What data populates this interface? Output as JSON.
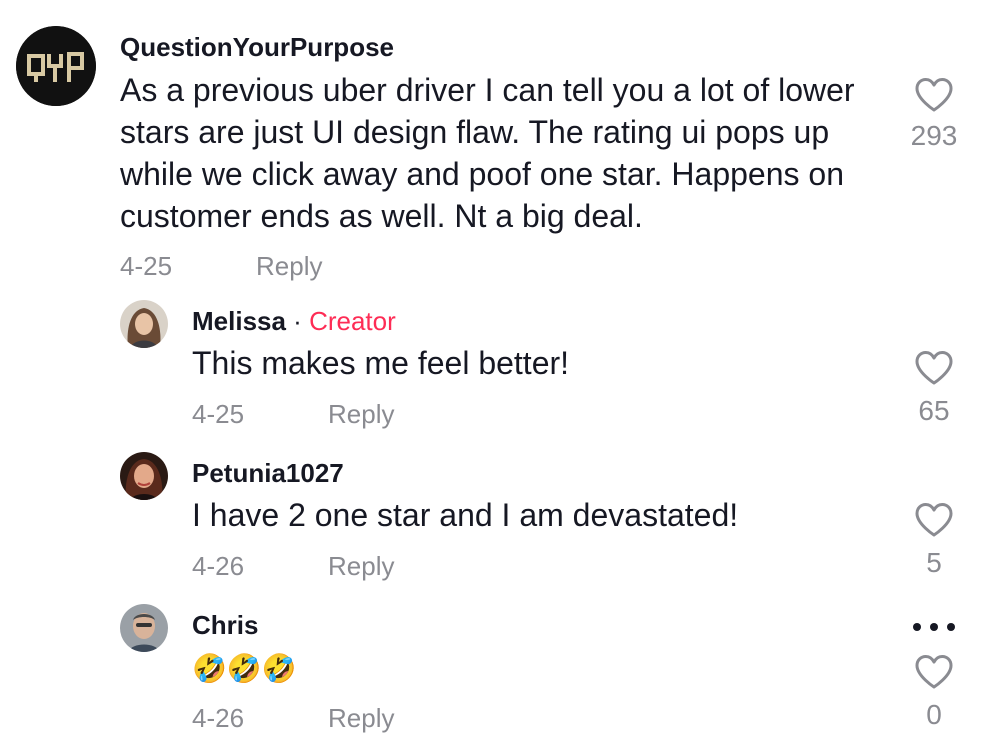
{
  "comments": [
    {
      "username": "QuestionYourPurpose",
      "avatar_text": "QYP",
      "text": "As a previous uber driver I can tell you a lot of lower stars are just UI design flaw. The rating ui pops up while we click away and poof one star. Happens on customer ends as well. Nt a big deal.",
      "date": "4-25",
      "reply_label": "Reply",
      "likes": "293"
    }
  ],
  "replies": [
    {
      "username": "Melissa",
      "separator": " · ",
      "badge": "Creator",
      "text": "This makes me feel better!",
      "date": "4-25",
      "reply_label": "Reply",
      "likes": "65"
    },
    {
      "username": "Petunia1027",
      "text": "I have 2 one star and I am devastated!",
      "date": "4-26",
      "reply_label": "Reply",
      "likes": "5"
    },
    {
      "username": "Chris",
      "text": "🤣🤣🤣",
      "date": "4-26",
      "reply_label": "Reply",
      "likes": "0"
    }
  ],
  "icons": {
    "like": "heart-outline-icon",
    "more": "more-options-icon"
  },
  "colors": {
    "text": "#161823",
    "secondary": "#8a8b91",
    "creator": "#fe2c55"
  }
}
